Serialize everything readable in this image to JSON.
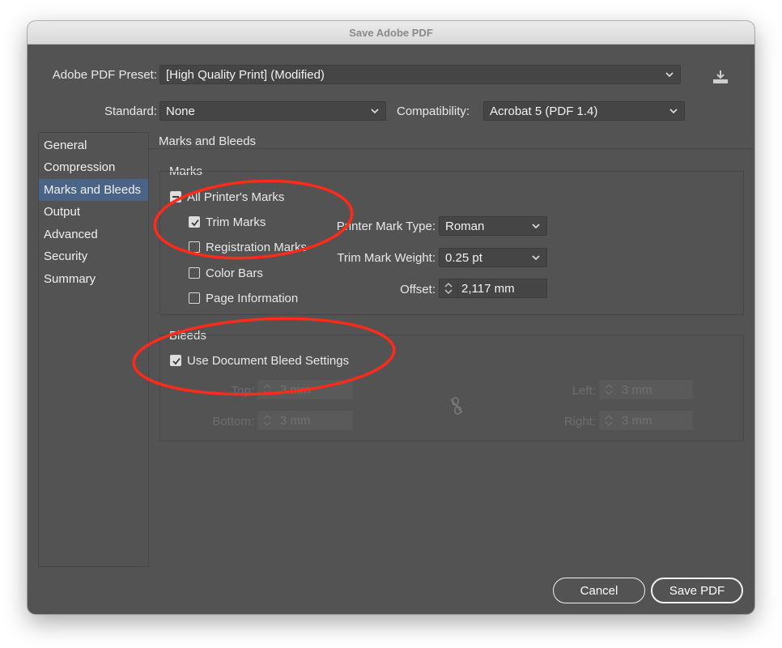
{
  "window": {
    "title": "Save Adobe PDF"
  },
  "preset": {
    "label": "Adobe PDF Preset:",
    "value": "[High Quality Print] (Modified)"
  },
  "standard": {
    "label": "Standard:",
    "value": "None"
  },
  "compatibility": {
    "label": "Compatibility:",
    "value": "Acrobat 5 (PDF 1.4)"
  },
  "sidebar": {
    "items": [
      {
        "label": "General"
      },
      {
        "label": "Compression"
      },
      {
        "label": "Marks and Bleeds",
        "selected": true
      },
      {
        "label": "Output"
      },
      {
        "label": "Advanced"
      },
      {
        "label": "Security"
      },
      {
        "label": "Summary"
      }
    ]
  },
  "panel": {
    "title": "Marks and Bleeds"
  },
  "marks": {
    "group_label": "Marks",
    "all_printers_marks": {
      "label": "All Printer's Marks",
      "state": "mixed"
    },
    "trim_marks": {
      "label": "Trim Marks",
      "checked": true
    },
    "registration_marks": {
      "label": "Registration Marks",
      "checked": false
    },
    "color_bars": {
      "label": "Color Bars",
      "checked": false
    },
    "page_information": {
      "label": "Page Information",
      "checked": false
    },
    "printer_mark_type": {
      "label": "Printer Mark Type:",
      "value": "Roman"
    },
    "trim_mark_weight": {
      "label": "Trim Mark Weight:",
      "value": "0.25 pt"
    },
    "offset": {
      "label": "Offset:",
      "value": "2,117 mm"
    }
  },
  "bleeds": {
    "group_label": "Bleeds",
    "use_document_bleed": {
      "label": "Use Document Bleed Settings",
      "checked": true
    },
    "top": {
      "label": "Top:",
      "value": "3 mm"
    },
    "bottom": {
      "label": "Bottom:",
      "value": "3 mm"
    },
    "left": {
      "label": "Left:",
      "value": "3 mm"
    },
    "right": {
      "label": "Right:",
      "value": "3 mm"
    }
  },
  "buttons": {
    "cancel": "Cancel",
    "save": "Save PDF"
  },
  "colors": {
    "dialog_bg": "#535353",
    "selection": "#4a6488",
    "annotation": "#ff2a1a"
  }
}
